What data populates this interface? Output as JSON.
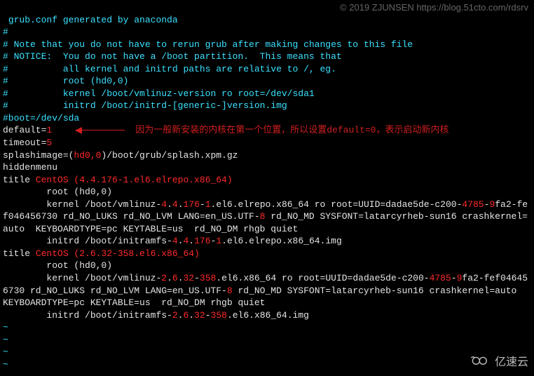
{
  "watermark_top": "© 2019 ZJUNSEN https://blog.51cto.com/rdsrv",
  "watermark_bottom": "亿速云",
  "lines": {
    "l0": " grub.conf generated by anaconda",
    "l1": "#",
    "l2": "# Note that you do not have to rerun grub after making changes to this file",
    "l3": "# NOTICE:  You do not have a /boot partition.  This means that",
    "l4": "#          all kernel and initrd paths are relative to /, eg.",
    "l5": "#          root (hd0,0)",
    "l6": "#          kernel /boot/vmlinuz-version ro root=/dev/sda1",
    "l7": "#          initrd /boot/initrd-[generic-]version.img",
    "l8": "#boot=/dev/sda",
    "default_key": "default=",
    "default_val": "1",
    "annotation": "因为一般新安装的内核在第一个位置，所以设置default=0，表示启动新内核",
    "timeout_key": "timeout=",
    "timeout_val": "5",
    "splash_a": "splashimage=(",
    "splash_hd": "hd0,0",
    "splash_b": ")/boot/grub/splash.xpm.gz",
    "hidden": "hiddenmenu",
    "title1_a": "title ",
    "title1_b": "CentOS (4.4.176-1.el6.elrepo.x86_64)",
    "root1": "        root (hd0,0)",
    "k1_a": "        kernel /boot/vmlinuz-",
    "k1_b": "4",
    "k1_c": ".",
    "k1_d": "4",
    "k1_e": ".",
    "k1_f": "176",
    "k1_g": "-",
    "k1_h": "1",
    "k1_i": ".el6.elrepo.x86_64 ro root=UUID=dadae5de-c200",
    "k1_j": "-",
    "k1_k": "4785",
    "k1_l": "-",
    "k1_m": "9",
    "k1_n": "fa2-fef046456730 rd_NO_LUKS rd_NO_LVM LANG=en_US.UTF-",
    "k1_o": "8",
    "k1_p": " rd_NO_MD SYSFONT=latarcyrheb-sun16 crashkernel=auto  KEYBOARDTYPE=pc KEYTABLE=us  rd_NO_DM rhgb quiet",
    "i1_a": "        initrd /boot/initramfs-",
    "i1_b": "4",
    "i1_c": ".",
    "i1_d": "4",
    "i1_e": ".",
    "i1_f": "176",
    "i1_g": "-",
    "i1_h": "1",
    "i1_i": ".el6.elrepo.x86_64.img",
    "title2_a": "title ",
    "title2_b": "CentOS (2.6.32-358.el6.x86_64)",
    "root2": "        root (hd0,0)",
    "k2_a": "        kernel /boot/vmlinuz-",
    "k2_b": "2",
    "k2_c": ".",
    "k2_d": "6",
    "k2_e": ".",
    "k2_f": "32",
    "k2_g": "-",
    "k2_h": "358",
    "k2_i": ".el6.x86_64 ro root=UUID=dadae5de-c200-",
    "k2_j": "4785",
    "k2_k": "-",
    "k2_l": "9",
    "k2_m": "fa2-fef046456730 rd_NO_LUKS rd_NO_LVM LANG=en_US.UTF-",
    "k2_n": "8",
    "k2_o": " rd_NO_MD SYSFONT=latarcyrheb-sun16 crashkernel=auto  KEYBOARDTYPE=pc KEYTABLE=us  rd_NO_DM rhgb quiet",
    "i2_a": "        initrd /boot/initramfs-",
    "i2_b": "2",
    "i2_c": ".",
    "i2_d": "6",
    "i2_e": ".",
    "i2_f": "32",
    "i2_g": "-",
    "i2_h": "358",
    "i2_i": ".el6.x86_64.img",
    "tilde": "~"
  }
}
